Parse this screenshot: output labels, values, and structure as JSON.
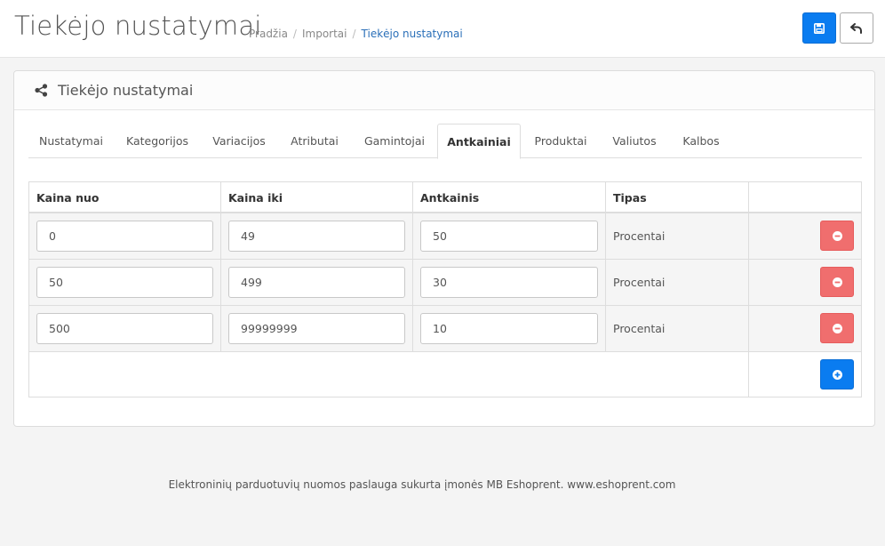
{
  "header": {
    "title": "Tiekėjo nustatymai",
    "breadcrumb": [
      "Pradžia",
      "Importai",
      "Tiekėjo nustatymai"
    ],
    "save_icon": "save-icon",
    "back_icon": "undo-icon"
  },
  "panel": {
    "title": "Tiekėjo nustatymai",
    "icon": "share-icon"
  },
  "tabs": [
    {
      "label": "Nustatymai"
    },
    {
      "label": "Kategorijos"
    },
    {
      "label": "Variacijos"
    },
    {
      "label": "Atributai"
    },
    {
      "label": "Gamintojai"
    },
    {
      "label": "Antkainiai",
      "active": true
    },
    {
      "label": "Produktai"
    },
    {
      "label": "Valiutos"
    },
    {
      "label": "Kalbos"
    }
  ],
  "table": {
    "columns": [
      "Kaina nuo",
      "Kaina iki",
      "Antkainis",
      "Tipas"
    ],
    "rows": [
      {
        "from": "0",
        "to": "49",
        "markup": "50",
        "type": "Procentai"
      },
      {
        "from": "50",
        "to": "499",
        "markup": "30",
        "type": "Procentai"
      },
      {
        "from": "500",
        "to": "99999999",
        "markup": "10",
        "type": "Procentai"
      }
    ]
  },
  "colors": {
    "primary": "#0a7cf0",
    "danger": "#f06e6e",
    "link": "#2a6fb8"
  },
  "footer": {
    "text": "Elektroninių parduotuvių nuomos paslauga sukurta įmonės MB Eshoprent. www.eshoprent.com"
  }
}
